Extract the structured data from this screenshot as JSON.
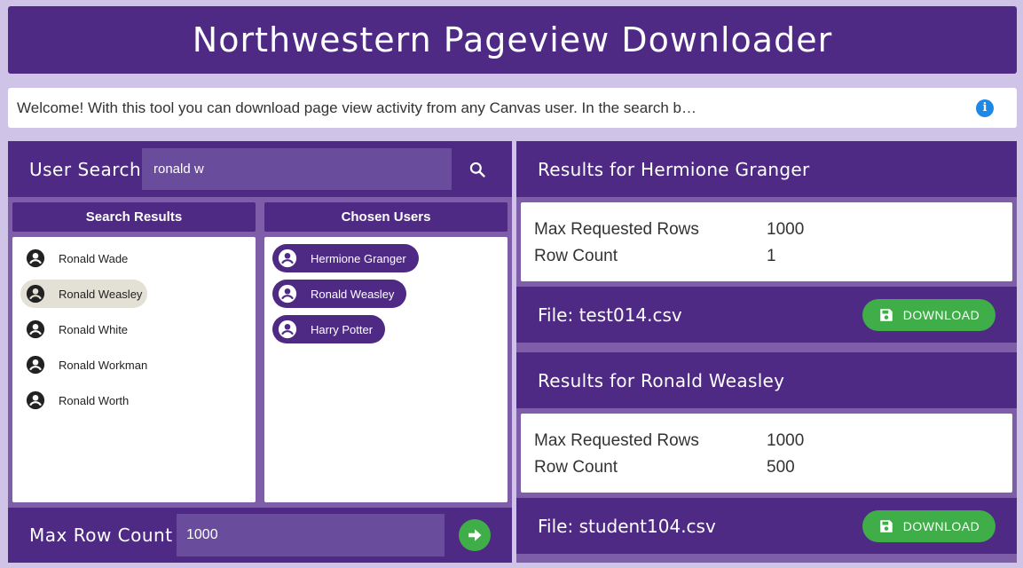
{
  "app": {
    "title": "Northwestern Pageview Downloader",
    "welcome": "Welcome! With this tool you can download page view activity from any Canvas user. In the search b…"
  },
  "search": {
    "label": "User Search",
    "value": "ronald w"
  },
  "search_results": {
    "header": "Search Results",
    "items": [
      {
        "name": "Ronald Wade",
        "selected": false
      },
      {
        "name": "Ronald Weasley",
        "selected": true
      },
      {
        "name": "Ronald White",
        "selected": false
      },
      {
        "name": "Ronald Workman",
        "selected": false
      },
      {
        "name": "Ronald Worth",
        "selected": false
      }
    ]
  },
  "chosen_users": {
    "header": "Chosen Users",
    "items": [
      "Hermione Granger",
      "Ronald Weasley",
      "Harry Potter"
    ]
  },
  "max_row": {
    "label": "Max Row Count",
    "value": "1000"
  },
  "results": [
    {
      "title": "Results for Hermione Granger",
      "max_rows_label": "Max Requested Rows",
      "max_rows": "1000",
      "row_count_label": "Row Count",
      "row_count": "1",
      "file": "File: test014.csv",
      "download_label": "DOWNLOAD"
    },
    {
      "title": "Results for Ronald Weasley",
      "max_rows_label": "Max Requested Rows",
      "max_rows": "1000",
      "row_count_label": "Row Count",
      "row_count": "500",
      "file": "File: student104.csv",
      "download_label": "DOWNLOAD"
    }
  ],
  "colors": {
    "primary": "#4e2a84",
    "background": "#cfc3e8",
    "accent_green": "#3fae49",
    "info_blue": "#1e88e5"
  },
  "icons": {
    "info": "info-icon",
    "search": "search-icon",
    "person": "account-circle-icon",
    "go": "arrow-right-icon",
    "download": "floppy-disk-icon"
  }
}
